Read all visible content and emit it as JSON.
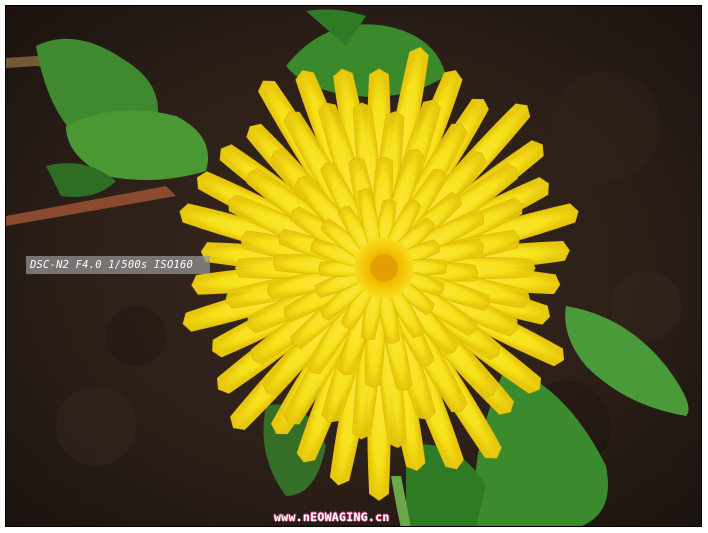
{
  "photo": {
    "subject": "yellow-dandelion-flower",
    "exif_caption": "DSC-N2 F4.0 1/500s ISO160",
    "watermark": "www.nEOWAGING.cn",
    "colors": {
      "soil": "#2a1e17",
      "petal": "#f6e21a",
      "petal_shadow": "#d9b60a",
      "center": "#f0c000",
      "leaf": "#3f8a2e",
      "stem": "#8a4a2e"
    }
  }
}
